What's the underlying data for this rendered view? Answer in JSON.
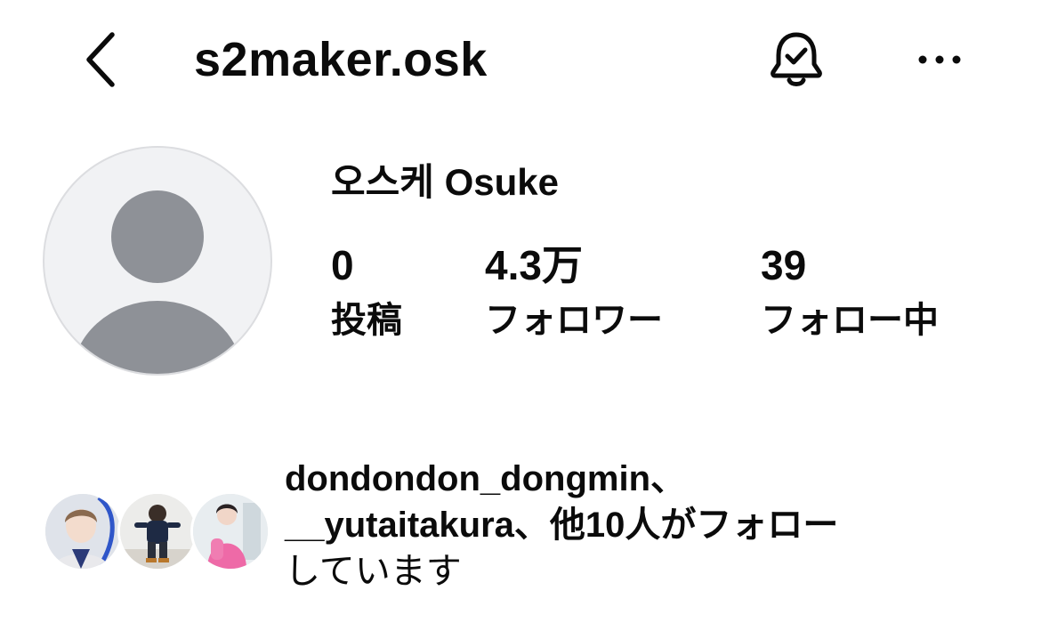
{
  "header": {
    "username": "s2maker.osk",
    "back_icon": "chevron-left-icon",
    "bell_icon": "bell-check-icon",
    "more_icon": "ellipsis-icon"
  },
  "profile": {
    "display_name": "오스케 Osuke",
    "avatar_icon": "default-person-icon"
  },
  "stats": {
    "posts": {
      "value": "0",
      "label": "投稿"
    },
    "followers": {
      "value": "4.3万",
      "label": "フォロワー"
    },
    "following": {
      "value": "39",
      "label": "フォロー中"
    }
  },
  "mutual_followers": {
    "line1": "dondondon_dongmin、",
    "line2": "__yutaitakura、他10人がフォロー",
    "line3": "しています"
  },
  "colors": {
    "text": "#0b0b0b",
    "avatar_bg": "#f1f2f4",
    "avatar_figure": "#8e9197"
  }
}
